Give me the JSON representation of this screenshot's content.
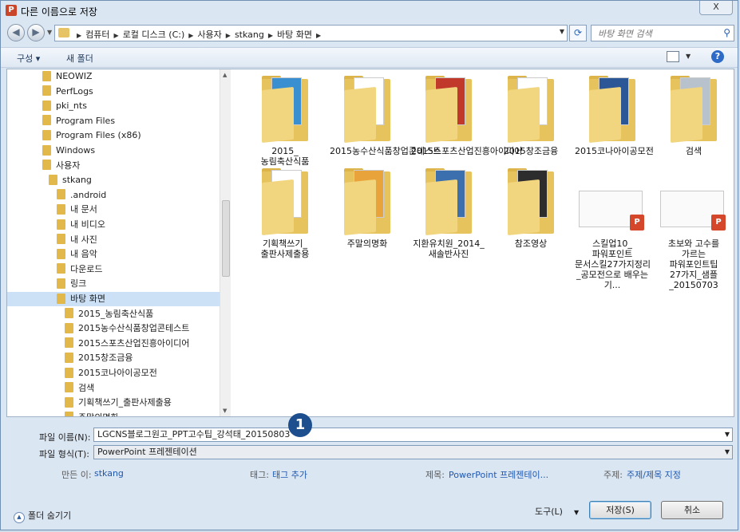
{
  "window": {
    "title": "다른 이름으로 저장",
    "app_icon": "P",
    "close_label": "X"
  },
  "address": {
    "crumbs": [
      "컴퓨터",
      "로컬 디스크 (C:)",
      "사용자",
      "stkang",
      "바탕 화면"
    ],
    "search_placeholder": "바탕 화면 검색"
  },
  "toolbar": {
    "organize_label": "구성 ▾",
    "new_folder_label": "새 폴더",
    "help_label": "?"
  },
  "tree": {
    "items": [
      {
        "label": "NEOWIZ",
        "indent": 1
      },
      {
        "label": "PerfLogs",
        "indent": 1
      },
      {
        "label": "pki_nts",
        "indent": 1
      },
      {
        "label": "Program Files",
        "indent": 1
      },
      {
        "label": "Program Files (x86)",
        "indent": 1
      },
      {
        "label": "Windows",
        "indent": 1
      },
      {
        "label": "사용자",
        "indent": 1
      },
      {
        "label": "stkang",
        "indent": 2
      },
      {
        "label": ".android",
        "indent": 3
      },
      {
        "label": "내 문서",
        "indent": 3
      },
      {
        "label": "내 비디오",
        "indent": 3
      },
      {
        "label": "내 사진",
        "indent": 3
      },
      {
        "label": "내 음악",
        "indent": 3
      },
      {
        "label": "다운로드",
        "indent": 3
      },
      {
        "label": "링크",
        "indent": 3
      },
      {
        "label": "바탕 화면",
        "indent": 3,
        "selected": true
      },
      {
        "label": "2015_농림축산식품",
        "indent": 4
      },
      {
        "label": "2015농수산식품창업콘테스트",
        "indent": 4
      },
      {
        "label": "2015스포츠산업진흥아이디어",
        "indent": 4
      },
      {
        "label": "2015창조금융",
        "indent": 4
      },
      {
        "label": "2015코나아이공모전",
        "indent": 4
      },
      {
        "label": "검색",
        "indent": 4
      },
      {
        "label": "기획책쓰기_출판사제출용",
        "indent": 4
      },
      {
        "label": "주말의명화",
        "indent": 4
      }
    ]
  },
  "files": [
    {
      "label": "2015_농림축산식품",
      "type": "folder",
      "paper": "#3a8fd0"
    },
    {
      "label": "2015농수산식품창업콘테스트",
      "type": "folder",
      "paper": "#ffffff"
    },
    {
      "label": "2015스포츠산업진흥아이디어",
      "type": "folder",
      "paper": "#c0392b"
    },
    {
      "label": "2015창조금융",
      "type": "folder",
      "paper": "#ffffff"
    },
    {
      "label": "2015코나아이공모전",
      "type": "folder",
      "paper": "#2b5797"
    },
    {
      "label": "검색",
      "type": "folder",
      "paper": "#b8c2cc"
    },
    {
      "label": "기획책쓰기_출판사제출용",
      "type": "folder",
      "paper": "#ffffff"
    },
    {
      "label": "주말의명화",
      "type": "folder",
      "paper": "#e8a33b"
    },
    {
      "label": "지환유치원_2014_새솔반사진",
      "type": "folder",
      "paper": "#3b6fae"
    },
    {
      "label": "참조영상",
      "type": "folder",
      "paper": "#2d2d2d"
    },
    {
      "label": "스킬업10_파워포인트 문서스킬27가지정리_공모전으로 배우는 기...",
      "type": "ppt"
    },
    {
      "label": "초보와 고수를 가르는 파워포인트팁 27가지_샘플_20150703",
      "type": "ppt"
    }
  ],
  "form": {
    "filename_label": "파일 이름(N):",
    "filename_value": "LGCNS블로그원고_PPT고수팁_강석태_20150803",
    "filetype_label": "파일 형식(T):",
    "filetype_value": "PowerPoint 프레젠테이션",
    "author_label": "만든 이:",
    "author_value": "stkang",
    "tags_label": "태그:",
    "tags_value": "태그 추가",
    "title_label": "제목:",
    "title_value": "PowerPoint 프레젠테이...",
    "subject_label": "주제:",
    "subject_value": "주제/제목 지정"
  },
  "callout_number": "1",
  "footer": {
    "hide_folders_label": "폴더 숨기기",
    "tools_label": "도구(L)",
    "save_label": "저장(S)",
    "cancel_label": "취소"
  }
}
